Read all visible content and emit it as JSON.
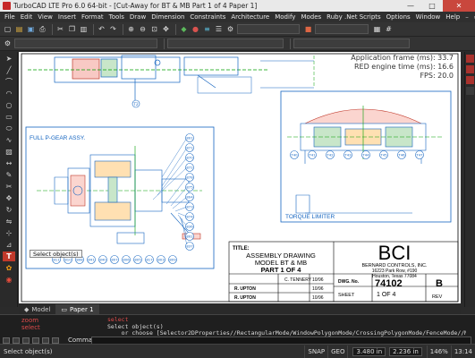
{
  "window": {
    "title": "TurboCAD LTE Pro 6.0 64-bit - [Cut-Away for BT & MB Part 1 of 4 Paper 1]",
    "min": "—",
    "max": "□",
    "close": "✕"
  },
  "menu": [
    "File",
    "Edit",
    "View",
    "Insert",
    "Format",
    "Tools",
    "Draw",
    "Dimension",
    "Constraints",
    "Architecture",
    "Modify",
    "Modes",
    "Ruby .Net Scripts",
    "Options",
    "Window",
    "Help"
  ],
  "menu_right": [
    "–",
    "▭",
    "×"
  ],
  "toolbar": {
    "combo1": "",
    "combo2": "",
    "combo3": ""
  },
  "perf": {
    "app_frame": "Application frame (ms): 33.7",
    "red_engine": "RED engine time (ms): 16.6",
    "fps": "FPS: 20.0"
  },
  "drawing": {
    "full_pgear": "FULL P-GEAR ASSY.",
    "torque_limiter": "TORQUE LIMITER",
    "title_label": "TITLE:",
    "title_line1": "ASSEMBLY DRAWING",
    "title_line2": "MODEL BT & MB",
    "title_line3": "PART 1 OF 4",
    "company_logo": "BCI",
    "company_name": "BERNARD CONTROLS, INC.",
    "company_addr1": "16223 Park Row, #190",
    "company_addr2": "Houston, Texas 77084",
    "dwg_no_label": "DWG. No.",
    "dwg_no": "74102",
    "rev": "B",
    "sheet_label": "SHEET",
    "sheet": "1 OF 4",
    "rev_label": "REV",
    "drawn_by": "C. TENNERY",
    "checked_by": "R. UPTON",
    "approved_by": "R. UPTON",
    "date1": "10/96",
    "date2": "10/96",
    "date3": "10/96",
    "balloons_top": [
      "T2"
    ],
    "balloons_pgear": [
      "801",
      "871",
      "870",
      "872",
      "878",
      "875",
      "804",
      "873",
      "874",
      "836",
      "802",
      "837"
    ],
    "balloons_bottom": [
      "811",
      "810",
      "808",
      "841",
      "840",
      "807",
      "806",
      "805",
      "817",
      "803",
      "809"
    ],
    "balloons_torque": [
      "T40",
      "T41",
      "T42",
      "T43",
      "T44",
      "T45",
      "T46",
      "T47"
    ]
  },
  "tooltip": "Select object(s)",
  "tabs": [
    {
      "label": "Model",
      "active": false
    },
    {
      "label": "Paper 1",
      "active": true
    }
  ],
  "command": {
    "left_lines": [
      "zoom",
      "select"
    ],
    "history_line1": "select",
    "history_line2": "Select object(s)",
    "history_line3": "    or choose [Selector2DProperties//RectangularMode/WindowPolygonMode/CrossingPolygonMode/FenceMode//M",
    "label": "Command"
  },
  "status": {
    "message": "Select object(s)",
    "snap": "SNAP",
    "geo": "GEO",
    "x": "3.480 in",
    "y": "2.236 in",
    "zoom": "146%",
    "time": "13:14"
  },
  "colors": {
    "drawing_blue": "#1565c0",
    "command_red": "#e04b4b",
    "close_button": "#c9473d"
  }
}
